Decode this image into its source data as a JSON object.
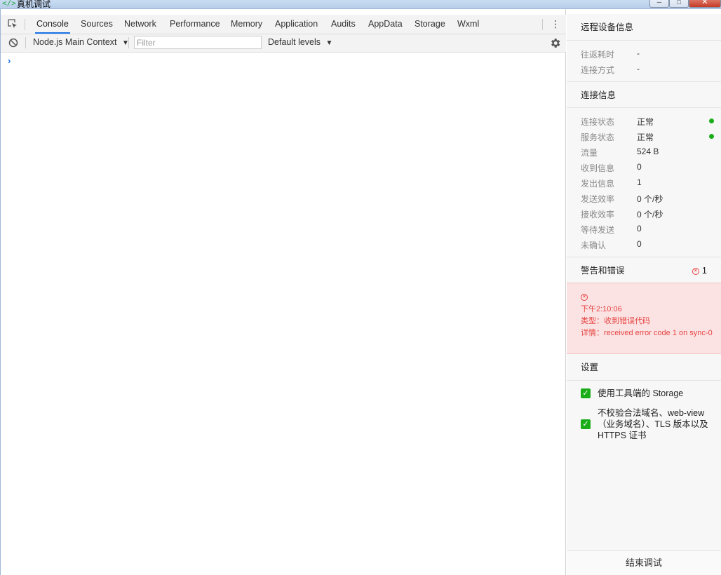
{
  "window": {
    "title": "真机调试",
    "icon": "code-brackets-icon",
    "controls": {
      "minimize": "─",
      "maximize": "□",
      "close": "✕"
    }
  },
  "tabs": [
    {
      "label": "Console",
      "active": true
    },
    {
      "label": "Sources"
    },
    {
      "label": "Network"
    },
    {
      "label": "Performance"
    },
    {
      "label": "Memory"
    },
    {
      "label": "Application"
    },
    {
      "label": "Audits"
    },
    {
      "label": "AppData"
    },
    {
      "label": "Storage"
    },
    {
      "label": "Wxml"
    }
  ],
  "toolbar": {
    "context": "Node.js Main Context",
    "filter_placeholder": "Filter",
    "levels": "Default levels",
    "dropdown_arrow": "▼"
  },
  "console": {
    "prompt": "›"
  },
  "panel": {
    "remote": {
      "title": "远程设备信息",
      "rows": [
        {
          "k": "往返耗时",
          "v": "-"
        },
        {
          "k": "连接方式",
          "v": "-"
        }
      ]
    },
    "connection": {
      "title": "连接信息",
      "rows": [
        {
          "k": "连接状态",
          "v": "正常",
          "status": "ok"
        },
        {
          "k": "服务状态",
          "v": "正常",
          "status": "ok"
        },
        {
          "k": "流量",
          "v": "524 B"
        },
        {
          "k": "收到信息",
          "v": "0"
        },
        {
          "k": "发出信息",
          "v": "1"
        },
        {
          "k": "发送效率",
          "v": "0 个/秒"
        },
        {
          "k": "接收效率",
          "v": "0 个/秒"
        },
        {
          "k": "等待发送",
          "v": "0"
        },
        {
          "k": "未确认",
          "v": "0"
        }
      ],
      "status_color": "#1aad19"
    },
    "warnings": {
      "title": "警告和错误",
      "count": "1",
      "error": {
        "time": "下午2:10:06",
        "type": "类型：收到错误代码",
        "detail": "详情：received error code 1 on sync-0"
      },
      "error_color": "#e64340"
    },
    "settings": {
      "title": "设置",
      "items": [
        {
          "label": "使用工具端的 Storage",
          "checked": true
        },
        {
          "label": "不校验合法域名、web-view（业务域名）、TLS 版本以及 HTTPS 证书",
          "checked": true
        }
      ],
      "check_mark": "✓"
    },
    "end_button": "结束调试"
  }
}
